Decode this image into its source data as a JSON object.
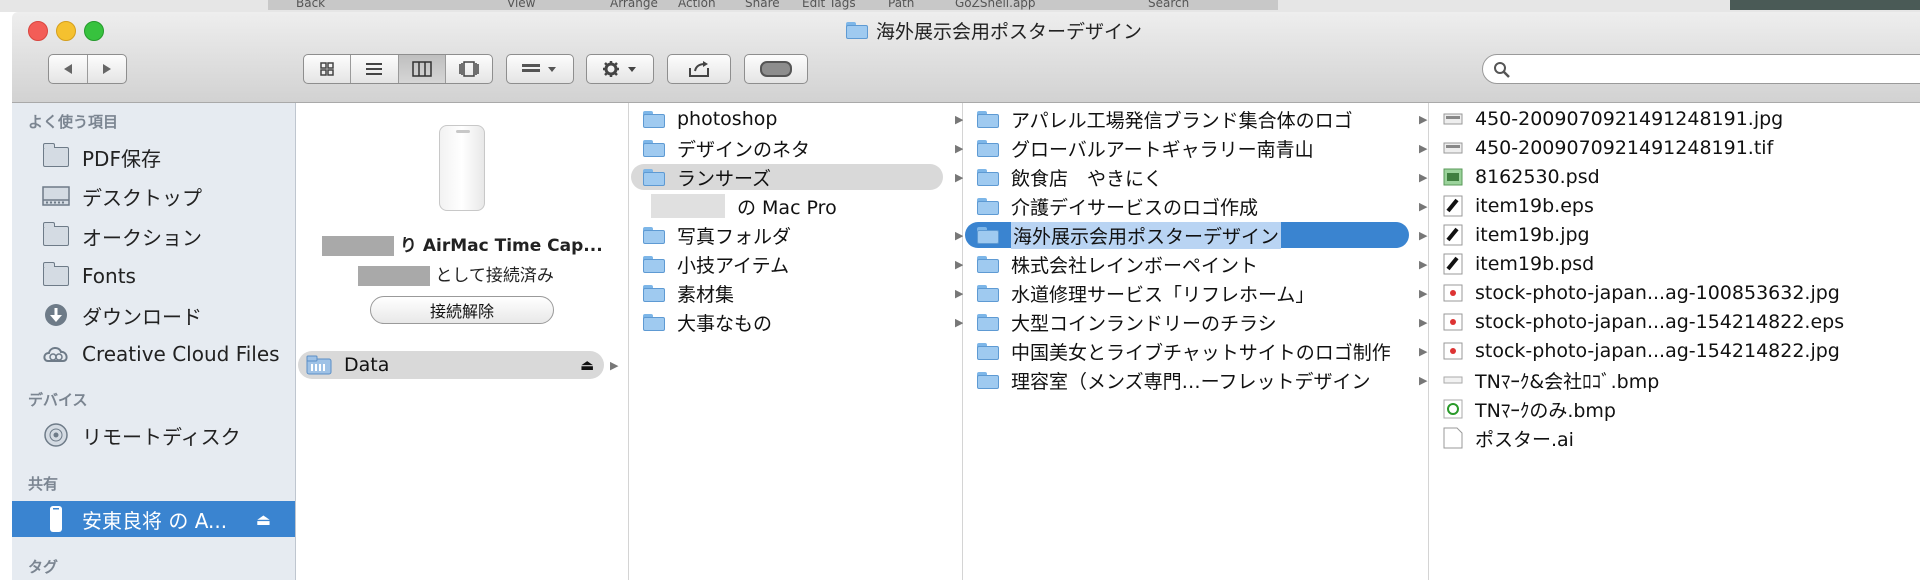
{
  "window": {
    "title": "海外展示会用ポスターデザイン"
  },
  "ghost_toolbar": {
    "labels": [
      "Back",
      "View",
      "Arrange",
      "Action",
      "Share",
      "Edit Tags",
      "Path",
      "GoZShell.app",
      "Search"
    ]
  },
  "sidebar": {
    "favorites_heading": "よく使う項目",
    "favorites": [
      {
        "label": "PDF保存",
        "icon": "folder-icon"
      },
      {
        "label": "デスクトップ",
        "icon": "desktop-icon"
      },
      {
        "label": "オークション",
        "icon": "folder-icon"
      },
      {
        "label": "Fonts",
        "icon": "folder-icon"
      },
      {
        "label": "ダウンロード",
        "icon": "download-icon"
      },
      {
        "label": "Creative Cloud Files",
        "icon": "creative-cloud-icon"
      }
    ],
    "devices_heading": "デバイス",
    "devices": [
      {
        "label": "リモートディスク",
        "icon": "remote-disc-icon"
      }
    ],
    "shared_heading": "共有",
    "shared": [
      {
        "label": "安東良将 の A...",
        "icon": "airmac-icon"
      }
    ],
    "tags_heading": "タグ"
  },
  "col0": {
    "device_name_suffix": "り AirMac Time Cap...",
    "connected_suffix": "として接続済み",
    "disconnect_label": "接続解除",
    "volume": "Data"
  },
  "col1": {
    "items": [
      {
        "label": "photoshop"
      },
      {
        "label": "デザインのネタ"
      },
      {
        "label": "ランサーズ"
      },
      {
        "label": "の Mac Pro"
      },
      {
        "label": "写真フォルダ"
      },
      {
        "label": "小技アイテム"
      },
      {
        "label": "素材集"
      },
      {
        "label": "大事なもの"
      }
    ]
  },
  "col2": {
    "items": [
      {
        "label": "アパレル工場発信ブランド集合体のロゴ"
      },
      {
        "label": "グローバルアートギャラリー南青山"
      },
      {
        "label": "飲食店　やきにく"
      },
      {
        "label": "介護デイサービスのロゴ作成"
      },
      {
        "label": "海外展示会用ポスターデザイン"
      },
      {
        "label": "株式会社レインボーペイント"
      },
      {
        "label": "水道修理サービス「リフレホーム」"
      },
      {
        "label": "大型コインランドリーのチラシ"
      },
      {
        "label": "中国美女とライブチャットサイトのロゴ制作"
      },
      {
        "label": "理容室（メンズ専門…ーフレットデザイン"
      }
    ]
  },
  "col3": {
    "items": [
      {
        "label": "450-2009070921491248191.jpg"
      },
      {
        "label": "450-2009070921491248191.tif"
      },
      {
        "label": "8162530.psd"
      },
      {
        "label": "item19b.eps"
      },
      {
        "label": "item19b.jpg"
      },
      {
        "label": "item19b.psd"
      },
      {
        "label": "stock-photo-japan...ag-100853632.jpg"
      },
      {
        "label": "stock-photo-japan...ag-154214822.eps"
      },
      {
        "label": "stock-photo-japan...ag-154214822.jpg"
      },
      {
        "label": "TNﾏｰｸ&会社ﾛｺﾞ.bmp"
      },
      {
        "label": "TNﾏｰｸのみ.bmp"
      },
      {
        "label": "ポスター.ai"
      }
    ]
  },
  "colors": {
    "selection_blue": "#3a84d0",
    "sidebar_bg": "#e6ebf1"
  }
}
